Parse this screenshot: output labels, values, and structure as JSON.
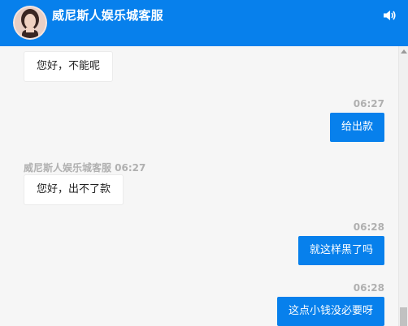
{
  "header": {
    "title": "威尼斯人娱乐城客服",
    "speaker_icon": "speaker-volume-icon",
    "avatar_icon": "agent-avatar"
  },
  "colors": {
    "header_bg": "#0780ec",
    "bubble_self": "#0780ec",
    "bubble_other": "#ffffff",
    "page_bg": "#f6f6f6",
    "timestamp": "#b0b0b0"
  },
  "messages": [
    {
      "from": "agent",
      "text": "您好，不能呢"
    },
    {
      "from": "user",
      "time": "06:27",
      "text": "给出款"
    },
    {
      "from": "agent",
      "sender": "威尼斯人娱乐城客服 06:27",
      "text": "您好，出不了款"
    },
    {
      "from": "user",
      "time": "06:28",
      "text": "就这样黑了吗"
    },
    {
      "from": "user",
      "time": "06:28",
      "text": "这点小钱没必要呀"
    }
  ]
}
